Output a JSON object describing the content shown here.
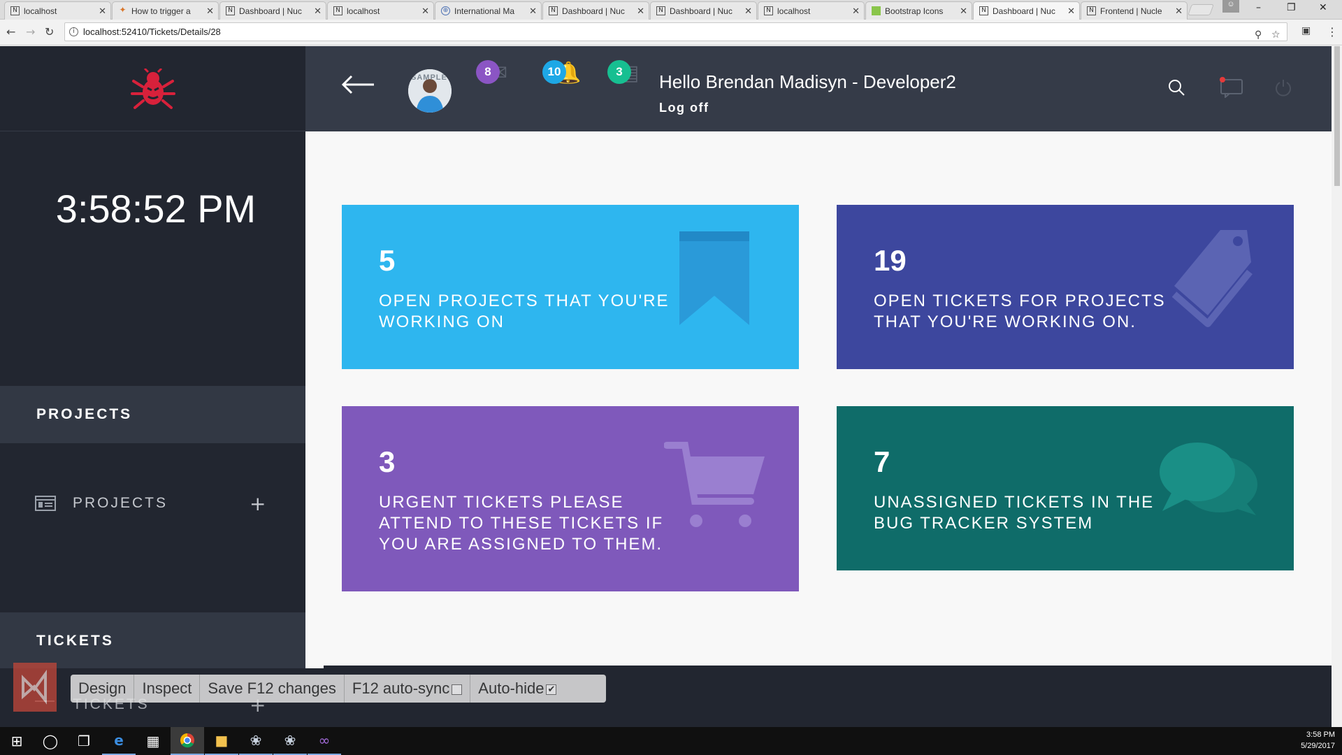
{
  "browser": {
    "tabs": [
      {
        "title": "localhost",
        "favicon": "N"
      },
      {
        "title": "How to trigger a",
        "favicon": "how"
      },
      {
        "title": "Dashboard | Nuc",
        "favicon": "N"
      },
      {
        "title": "localhost",
        "favicon": "N"
      },
      {
        "title": "International Ma",
        "favicon": "globe"
      },
      {
        "title": "Dashboard | Nuc",
        "favicon": "N"
      },
      {
        "title": "Dashboard | Nuc",
        "favicon": "N"
      },
      {
        "title": "localhost",
        "favicon": "N"
      },
      {
        "title": "Bootstrap Icons",
        "favicon": "bs"
      },
      {
        "title": "Dashboard | Nuc",
        "favicon": "N",
        "active": true
      },
      {
        "title": "Frontend | Nucle",
        "favicon": "N"
      }
    ],
    "url": "localhost:52410/Tickets/Details/28"
  },
  "sidebar": {
    "clock": "3:58:52 PM",
    "projects_header": "PROJECTS",
    "projects_item": "PROJECTS",
    "tickets_header": "TICKETS",
    "tickets_item": "TICKETS",
    "add_glyph": "+"
  },
  "topbar": {
    "badges": [
      {
        "count": "8",
        "color": "#8b55c4",
        "icon": "envelope-icon"
      },
      {
        "count": "10",
        "color": "#1ea8e6",
        "icon": "bell-icon"
      },
      {
        "count": "3",
        "color": "#17bf91",
        "icon": "tasks-icon"
      }
    ],
    "greeting": "Hello Brendan Madisyn  - Developer2",
    "logoff": "Log off",
    "avatar_watermark": "SAMPLE"
  },
  "cards": [
    {
      "count": "5",
      "label": "Open Projects that you're working on",
      "color": "#2eb6ef",
      "icon": "bookmark-icon"
    },
    {
      "count": "19",
      "label": "Open Tickets for projects that you're working on.",
      "color": "#3d479e",
      "icon": "tags-icon"
    },
    {
      "count": "3",
      "label": "Urgent tickets please attend to these tickets if you are assigned to them.",
      "color": "#7f59bb",
      "icon": "cart-icon"
    },
    {
      "count": "7",
      "label": "Unassigned tickets in the bug tracker system",
      "color": "#0f6c69",
      "icon": "chat-icon"
    }
  ],
  "vs_toolbar": {
    "design": "Design",
    "inspect": "Inspect",
    "save": "Save F12 changes",
    "autosync": "F12 auto-sync",
    "autohide": "Auto-hide"
  },
  "taskbar": {
    "time": "3:58 PM",
    "date": "5/29/2017"
  }
}
